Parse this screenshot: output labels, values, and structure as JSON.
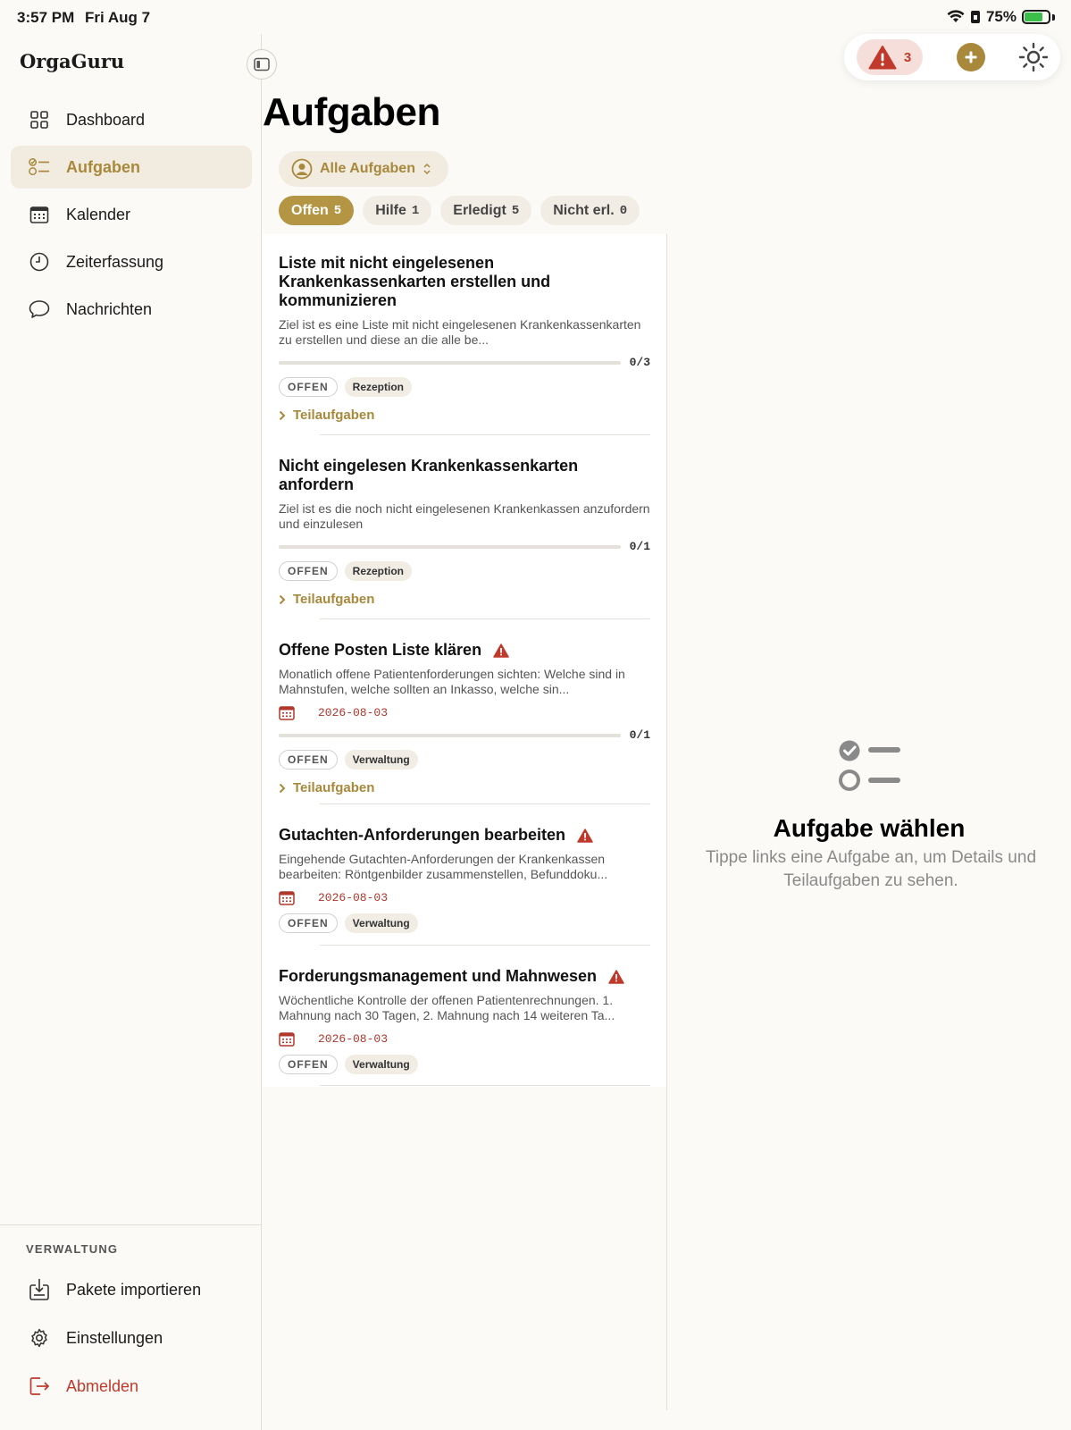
{
  "status": {
    "time": "3:57 PM",
    "date": "Fri Aug 7",
    "battery": "75%"
  },
  "sidebar": {
    "brand": "OrgaGuru",
    "items": [
      {
        "label": "Dashboard",
        "icon": "grid-icon"
      },
      {
        "label": "Aufgaben",
        "icon": "checklist-icon",
        "active": true
      },
      {
        "label": "Kalender",
        "icon": "calendar-icon"
      },
      {
        "label": "Zeiterfassung",
        "icon": "clock-icon"
      },
      {
        "label": "Nachrichten",
        "icon": "chat-bubble-icon"
      }
    ],
    "section_label": "VERWALTUNG",
    "bottom_items": [
      {
        "label": "Pakete importieren",
        "icon": "import-icon"
      },
      {
        "label": "Einstellungen",
        "icon": "gear-icon"
      },
      {
        "label": "Abmelden",
        "icon": "logout-icon"
      }
    ]
  },
  "toolbar": {
    "alert_count": "3"
  },
  "main": {
    "title": "Aufgaben",
    "filter_label": "Alle Aufgaben",
    "tabs": [
      {
        "label": "Offen",
        "count": "5",
        "active": true
      },
      {
        "label": "Hilfe",
        "count": "1"
      },
      {
        "label": "Erledigt",
        "count": "5"
      },
      {
        "label": "Nicht erl.",
        "count": "0"
      }
    ],
    "tasks": [
      {
        "title": "Liste mit nicht eingelesenen Krankenkassenkarten erstellen und kommunizieren",
        "desc": "Ziel ist es eine Liste mit nicht eingelesenen Krankenkassenkarten zu erstellen und diese an die alle be...",
        "progress": "0/3",
        "status": "OFFEN",
        "category": "Rezeption",
        "subtasks": "Teilaufgaben"
      },
      {
        "title": "Nicht eingelesen Krankenkassenkarten anfordern",
        "desc": "Ziel ist es die noch nicht eingelesenen Krankenkassen anzufordern und einzulesen",
        "progress": "0/1",
        "status": "OFFEN",
        "category": "Rezeption",
        "subtasks": "Teilaufgaben"
      },
      {
        "title": "Offene Posten Liste klären",
        "desc": "Monatlich offene Patientenforderungen sichten: Welche sind in Mahnstufen, welche sollten an Inkasso, welche sin...",
        "date": "2026-08-03",
        "progress": "0/1",
        "status": "OFFEN",
        "category": "Verwaltung",
        "subtasks": "Teilaufgaben"
      },
      {
        "title": "Gutachten-Anforderungen bearbeiten",
        "desc": "Eingehende Gutachten-Anforderungen der Krankenkassen bearbeiten: Röntgenbilder zusammenstellen, Befunddoku...",
        "date": "2026-08-03",
        "status": "OFFEN",
        "category": "Verwaltung"
      },
      {
        "title": "Forderungsmanagement und Mahnwesen",
        "desc": "Wöchentliche Kontrolle der offenen Patientenrechnungen. 1. Mahnung nach 30 Tagen, 2. Mahnung nach 14 weiteren Ta...",
        "date": "2026-08-03",
        "status": "OFFEN",
        "category": "Verwaltung"
      }
    ]
  },
  "detail": {
    "title": "Aufgabe wählen",
    "subtitle": "Tippe links eine Aufgabe an, um Details und Teilaufgaben zu sehen."
  },
  "colors": {
    "accent": "#a8893c",
    "danger": "#c0392b",
    "background": "#fbfaf7"
  }
}
